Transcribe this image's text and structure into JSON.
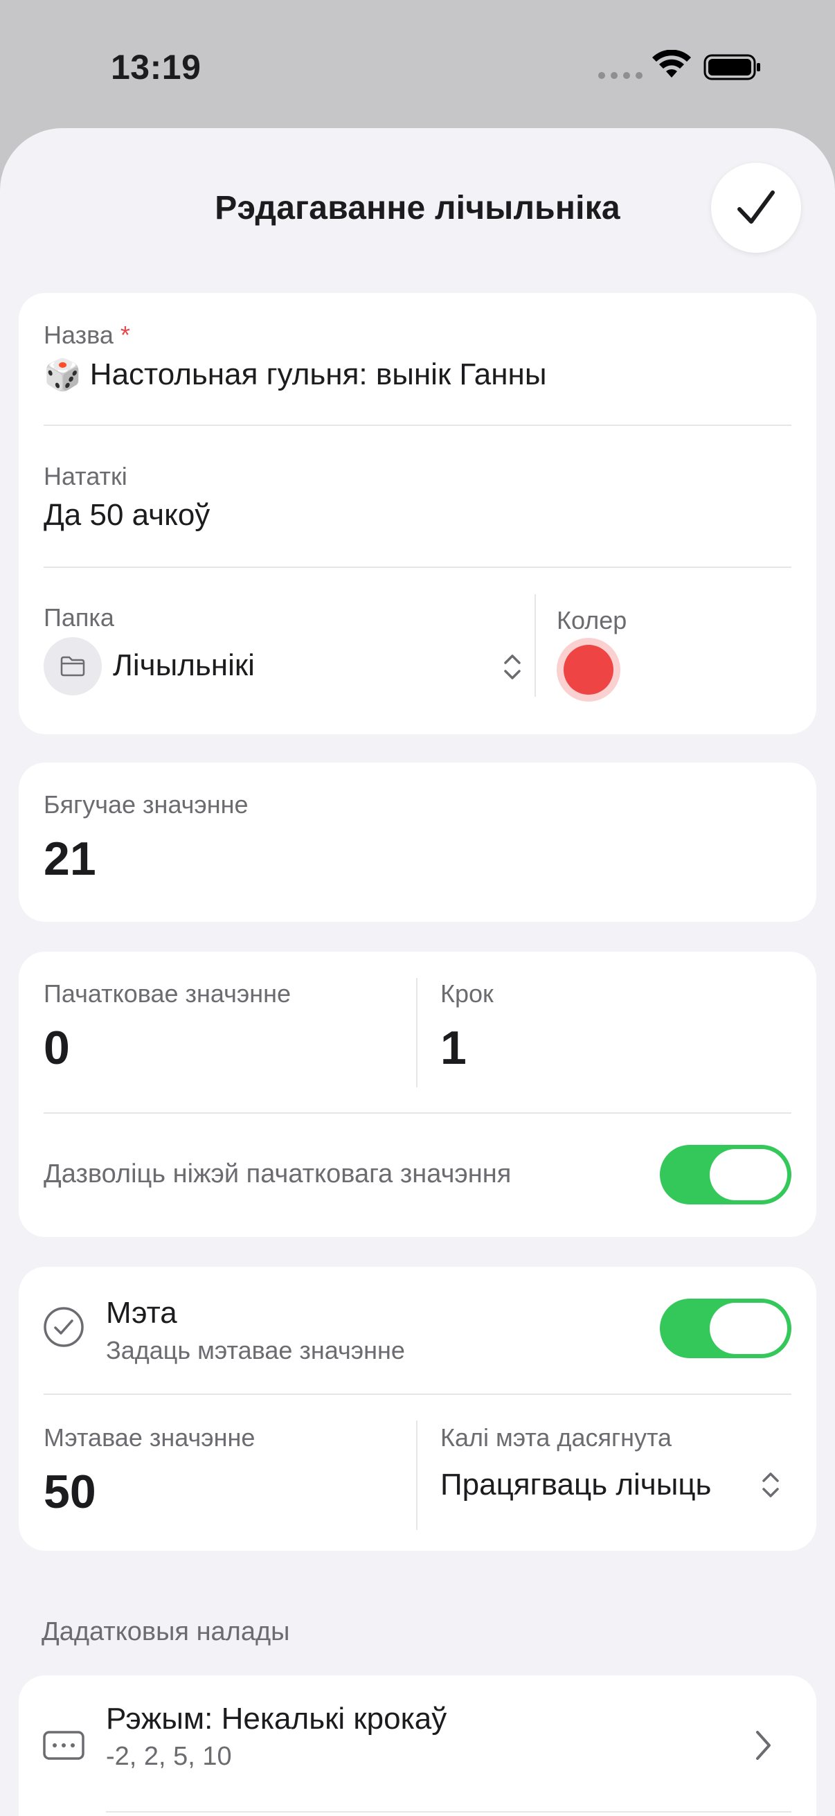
{
  "status": {
    "time": "13:19"
  },
  "header": {
    "title": "Рэдагаванне лічыльніка"
  },
  "name_field": {
    "label": "Назва",
    "required_mark": "*",
    "emoji": "🎲",
    "value": "Настольная гульня: вынік Ганны"
  },
  "notes_field": {
    "label": "Нататкі",
    "value": "Да 50 ачкоў"
  },
  "folder_field": {
    "label": "Папка",
    "value": "Лічыльнікі"
  },
  "color_field": {
    "label": "Колер",
    "value": "#ee4444"
  },
  "current_value": {
    "label": "Бягучае значэнне",
    "value": "21"
  },
  "initial_value": {
    "label": "Пачатковае значэнне",
    "value": "0"
  },
  "step": {
    "label": "Крок",
    "value": "1"
  },
  "allow_below_initial": {
    "label": "Дазволіць ніжэй пачатковага значэння",
    "enabled": true
  },
  "goal": {
    "title": "Мэта",
    "subtitle": "Задаць мэтавае значэнне",
    "enabled": true
  },
  "goal_value": {
    "label": "Мэтавае значэнне",
    "value": "50"
  },
  "on_goal_reached": {
    "label": "Калі мэта дасягнута",
    "value": "Працягваць лічыць"
  },
  "additional": {
    "header": "Дадатковыя налады",
    "mode": {
      "title": "Рэжым: Некалькі крокаў",
      "subtitle": "-2, 2, 5, 10"
    }
  },
  "colors": {
    "accent_toggle": "#34c759",
    "required": "#e5484d"
  }
}
